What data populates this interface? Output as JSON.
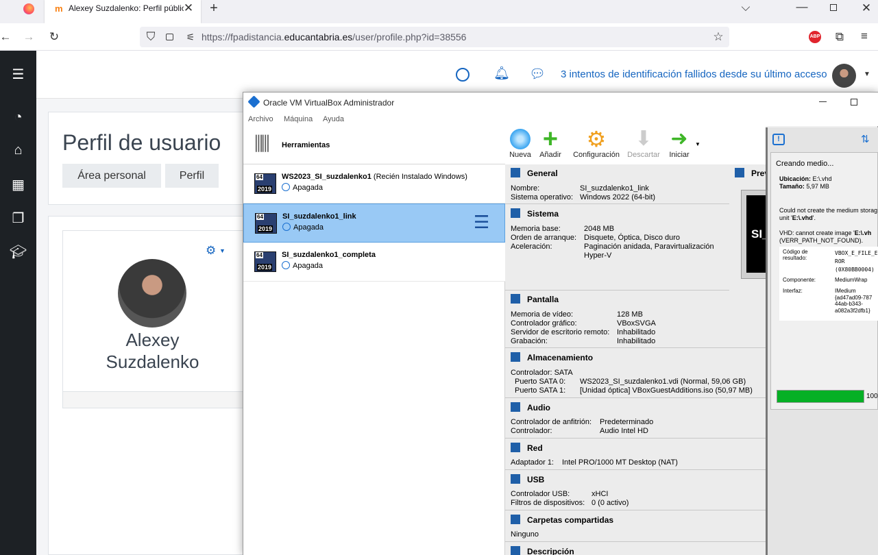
{
  "browser": {
    "tab_title": "Alexey Suzdalenko: Perfil públic",
    "url_prefix": "https://fpadistancia.",
    "url_domain": "educantabria.es",
    "url_path": "/user/profile.php?id=38556"
  },
  "moodle": {
    "alert_text": "3 intentos de identificación fallidos desde su último acceso",
    "page_title": "Perfil de usuario",
    "breadcrumb": [
      "Área personal",
      "Perfil"
    ],
    "user_name_line1": "Alexey",
    "user_name_line2": "Suzdalenko"
  },
  "vbox": {
    "window_title": "Oracle VM VirtualBox Administrador",
    "menu": [
      "Archivo",
      "Máquina",
      "Ayuda"
    ],
    "tools_label": "Herramientas",
    "toolbar": [
      "Nueva",
      "Añadir",
      "Configuración",
      "Descartar",
      "Iniciar"
    ],
    "vms": [
      {
        "name": "WS2023_SI_suzdalenko1",
        "note": "(Recién Instalado Windows)",
        "state": "Apagada",
        "badge_top": "64",
        "badge_year": "2019"
      },
      {
        "name": "SI_suzdalenko1_link",
        "note": "",
        "state": "Apagada",
        "badge_top": "64",
        "badge_year": "2019"
      },
      {
        "name": "SI_suzdalenko1_completa",
        "note": "",
        "state": "Apagada",
        "badge_top": "64",
        "badge_year": "2019"
      }
    ],
    "general": {
      "title": "General",
      "k1": "Nombre:",
      "v1": "SI_suzdalenko1_link",
      "k2": "Sistema operativo:",
      "v2": "Windows 2022 (64-bit)"
    },
    "preview_title": "Prev",
    "preview_text": "SI_",
    "sistema": {
      "title": "Sistema",
      "k1": "Memoria base:",
      "v1": "2048 MB",
      "k2": "Orden de arranque:",
      "v2": "Disquete, Óptica, Disco duro",
      "k3": "Aceleración:",
      "v3": "Paginación anidada, Paravirtualización",
      "v3b": "Hyper-V"
    },
    "pantalla": {
      "title": "Pantalla",
      "k1": "Memoria de vídeo:",
      "v1": "128 MB",
      "k2": "Controlador gráfico:",
      "v2": "VBoxSVGA",
      "k3": "Servidor de escritorio remoto:",
      "v3": "Inhabilitado",
      "k4": "Grabación:",
      "v4": "Inhabilitado"
    },
    "almacenamiento": {
      "title": "Almacenamiento",
      "k1": "Controlador: SATA",
      "k2": "Puerto SATA 0:",
      "v2": "WS2023_SI_suzdalenko1.vdi (Normal, 59,06 GB)",
      "k3": "Puerto SATA 1:",
      "v3": "[Unidad óptica] VBoxGuestAdditions.iso (50,97 MB)"
    },
    "audio": {
      "title": "Audio",
      "k1": "Controlador de anfitrión:",
      "v1": "Predeterminado",
      "k2": "Controlador:",
      "v2": "Audio Intel HD"
    },
    "red": {
      "title": "Red",
      "k1": "Adaptador 1:",
      "v1": "Intel PRO/1000 MT Desktop (NAT)"
    },
    "usb": {
      "title": "USB",
      "k1": "Controlador USB:",
      "v1": "xHCI",
      "k2": "Filtros de dispositivos:",
      "v2": "0 (0 activo)"
    },
    "carpetas": {
      "title": "Carpetas compartidas",
      "k1": "Ninguno"
    },
    "descripcion": {
      "title": "Descripción"
    }
  },
  "notification": {
    "title": "Creando medio...",
    "loc_k": "Ubicación:",
    "loc_v": "E:\\.vhd",
    "size_k": "Tamaño:",
    "size_v": "5,97 MB",
    "err1": "Could not create the medium storag",
    "err2a": "unit '",
    "err2b": "E:\\.vhd",
    "err2c": "'.",
    "err3a": "VHD: cannot create image '",
    "err3b": "E:\\.vh",
    "err4": "(VERR_PATH_NOT_FOUND).",
    "code_k1": "Código de",
    "code_k2": "resultado:",
    "code_v1": "VBOX_E_FILE_E",
    "code_v2": "ROR",
    "code_v3": "(0X80BB0004)",
    "comp_k": "Componente:",
    "comp_v": "MediumWrap",
    "iface_k": "Interfaz:",
    "iface_v1": "IMedium",
    "iface_v2": "{ad47ad09-787",
    "iface_v3": "44ab-b343-",
    "iface_v4": "a082a3f2dfb1}",
    "progress_percent": 100,
    "progress_label": "100"
  },
  "colors": {
    "accent": "#1565c0",
    "selected": "#99c9f5",
    "progress": "#06b025",
    "sidebar": "#1d2125"
  }
}
